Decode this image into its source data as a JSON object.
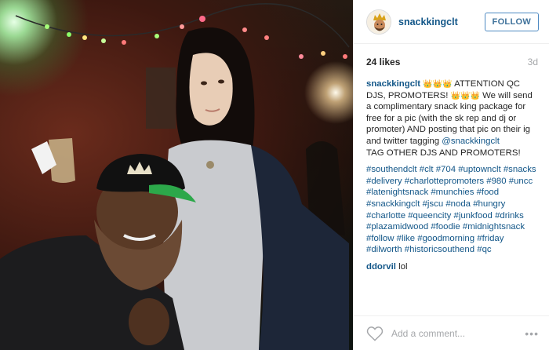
{
  "photo": {
    "alt": ""
  },
  "account": {
    "username": "snackkingclt",
    "avatar_icon": "snack-king-avatar-icon"
  },
  "header": {
    "follow_label": "FOLLOW"
  },
  "stats": {
    "likes": "24 likes",
    "time_ago": "3d"
  },
  "caption": {
    "username": "snackkingclt",
    "emoji": "👑",
    "part1": " ATTENTION QC DJS, PROMOTERS! ",
    "part2": "  We will send a complimentary snack king package for free for a pic (with the sk rep and dj or promoter) AND posting that pic on their ig and twitter tagging ",
    "mention": "@snackkingclt",
    "part3": " TAG OTHER DJS AND PROMOTERS!"
  },
  "hashtags": [
    "#southendclt",
    "#clt",
    "#704",
    "#uptownclt",
    "#snacks",
    "#delivery",
    "#charlottepromoters",
    "#980",
    "#uncc",
    "#latenightsnack",
    "#munchies",
    "#food",
    "#snackkingclt",
    "#jscu",
    "#noda",
    "#hungry",
    "#charlotte",
    "#queencity",
    "#junkfood",
    "#drinks",
    "#plazamidwood",
    "#foodie",
    "#midnightsnack",
    "#follow",
    "#like",
    "#goodmorning",
    "#friday",
    "#dilworth",
    "#historicsouthend",
    "#qc"
  ],
  "reply": {
    "username": "ddorvil",
    "text": "lol"
  },
  "footer": {
    "comment_placeholder": "Add a comment...",
    "more_label": "•••",
    "like_icon": "heart-icon"
  },
  "colors": {
    "link": "#125688",
    "follow_border": "#4e8ac2",
    "muted": "#a5a7aa"
  }
}
